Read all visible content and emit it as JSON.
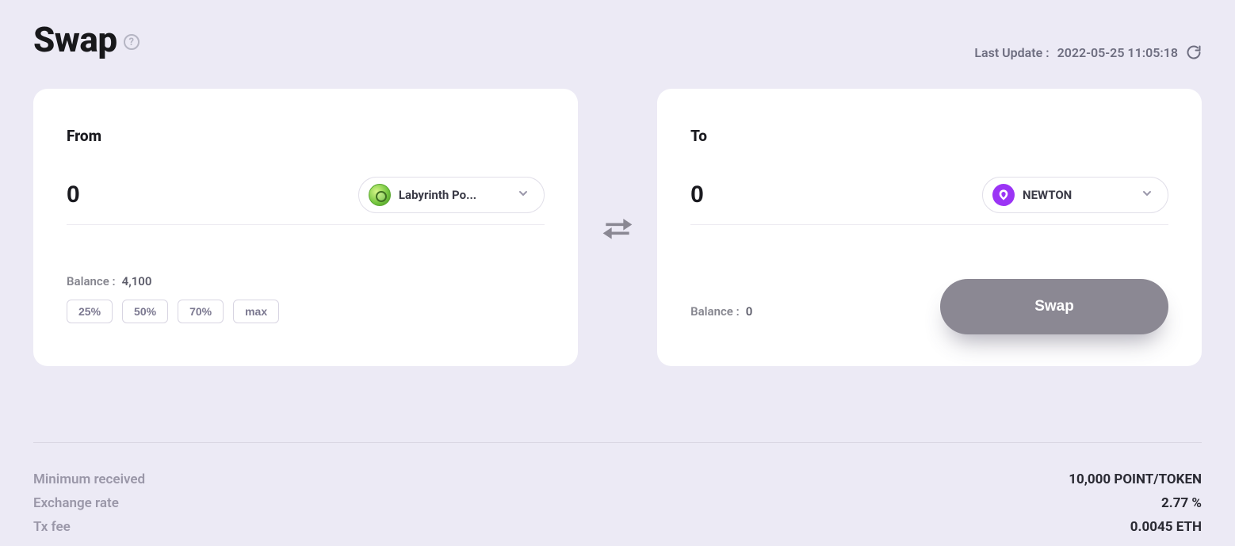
{
  "page": {
    "title": "Swap",
    "lastUpdatePrefix": "Last Update :",
    "lastUpdate": "2022-05-25 11:05:18"
  },
  "from": {
    "label": "From",
    "amount": "0",
    "token": "Labyrinth Po...",
    "balanceLabel": "Balance :",
    "balance": "4,100",
    "percentButtons": [
      "25%",
      "50%",
      "70%",
      "max"
    ]
  },
  "to": {
    "label": "To",
    "amount": "0",
    "token": "NEWTON",
    "balanceLabel": "Balance :",
    "balance": "0",
    "swapButton": "Swap"
  },
  "details": {
    "rows": [
      {
        "label": "Minimum received",
        "value": "10,000 POINT/TOKEN"
      },
      {
        "label": "Exchange rate",
        "value": "2.77 %"
      },
      {
        "label": "Tx fee",
        "value": "0.0045 ETH"
      }
    ]
  }
}
